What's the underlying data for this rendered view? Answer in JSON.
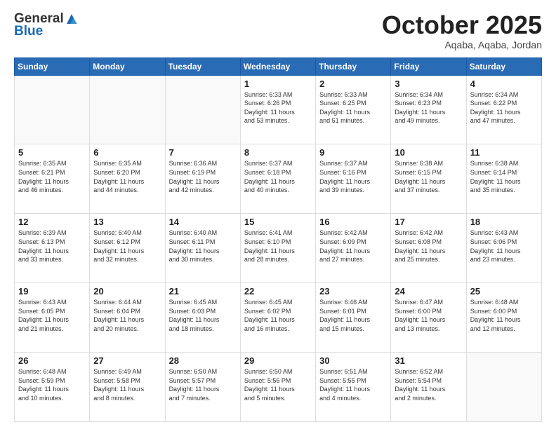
{
  "header": {
    "logo_line1": "General",
    "logo_line2": "Blue",
    "month": "October 2025",
    "location": "Aqaba, Aqaba, Jordan"
  },
  "weekdays": [
    "Sunday",
    "Monday",
    "Tuesday",
    "Wednesday",
    "Thursday",
    "Friday",
    "Saturday"
  ],
  "weeks": [
    [
      {
        "day": "",
        "info": ""
      },
      {
        "day": "",
        "info": ""
      },
      {
        "day": "",
        "info": ""
      },
      {
        "day": "1",
        "info": "Sunrise: 6:33 AM\nSunset: 6:26 PM\nDaylight: 11 hours\nand 53 minutes."
      },
      {
        "day": "2",
        "info": "Sunrise: 6:33 AM\nSunset: 6:25 PM\nDaylight: 11 hours\nand 51 minutes."
      },
      {
        "day": "3",
        "info": "Sunrise: 6:34 AM\nSunset: 6:23 PM\nDaylight: 11 hours\nand 49 minutes."
      },
      {
        "day": "4",
        "info": "Sunrise: 6:34 AM\nSunset: 6:22 PM\nDaylight: 11 hours\nand 47 minutes."
      }
    ],
    [
      {
        "day": "5",
        "info": "Sunrise: 6:35 AM\nSunset: 6:21 PM\nDaylight: 11 hours\nand 46 minutes."
      },
      {
        "day": "6",
        "info": "Sunrise: 6:35 AM\nSunset: 6:20 PM\nDaylight: 11 hours\nand 44 minutes."
      },
      {
        "day": "7",
        "info": "Sunrise: 6:36 AM\nSunset: 6:19 PM\nDaylight: 11 hours\nand 42 minutes."
      },
      {
        "day": "8",
        "info": "Sunrise: 6:37 AM\nSunset: 6:18 PM\nDaylight: 11 hours\nand 40 minutes."
      },
      {
        "day": "9",
        "info": "Sunrise: 6:37 AM\nSunset: 6:16 PM\nDaylight: 11 hours\nand 39 minutes."
      },
      {
        "day": "10",
        "info": "Sunrise: 6:38 AM\nSunset: 6:15 PM\nDaylight: 11 hours\nand 37 minutes."
      },
      {
        "day": "11",
        "info": "Sunrise: 6:38 AM\nSunset: 6:14 PM\nDaylight: 11 hours\nand 35 minutes."
      }
    ],
    [
      {
        "day": "12",
        "info": "Sunrise: 6:39 AM\nSunset: 6:13 PM\nDaylight: 11 hours\nand 33 minutes."
      },
      {
        "day": "13",
        "info": "Sunrise: 6:40 AM\nSunset: 6:12 PM\nDaylight: 11 hours\nand 32 minutes."
      },
      {
        "day": "14",
        "info": "Sunrise: 6:40 AM\nSunset: 6:11 PM\nDaylight: 11 hours\nand 30 minutes."
      },
      {
        "day": "15",
        "info": "Sunrise: 6:41 AM\nSunset: 6:10 PM\nDaylight: 11 hours\nand 28 minutes."
      },
      {
        "day": "16",
        "info": "Sunrise: 6:42 AM\nSunset: 6:09 PM\nDaylight: 11 hours\nand 27 minutes."
      },
      {
        "day": "17",
        "info": "Sunrise: 6:42 AM\nSunset: 6:08 PM\nDaylight: 11 hours\nand 25 minutes."
      },
      {
        "day": "18",
        "info": "Sunrise: 6:43 AM\nSunset: 6:06 PM\nDaylight: 11 hours\nand 23 minutes."
      }
    ],
    [
      {
        "day": "19",
        "info": "Sunrise: 6:43 AM\nSunset: 6:05 PM\nDaylight: 11 hours\nand 21 minutes."
      },
      {
        "day": "20",
        "info": "Sunrise: 6:44 AM\nSunset: 6:04 PM\nDaylight: 11 hours\nand 20 minutes."
      },
      {
        "day": "21",
        "info": "Sunrise: 6:45 AM\nSunset: 6:03 PM\nDaylight: 11 hours\nand 18 minutes."
      },
      {
        "day": "22",
        "info": "Sunrise: 6:45 AM\nSunset: 6:02 PM\nDaylight: 11 hours\nand 16 minutes."
      },
      {
        "day": "23",
        "info": "Sunrise: 6:46 AM\nSunset: 6:01 PM\nDaylight: 11 hours\nand 15 minutes."
      },
      {
        "day": "24",
        "info": "Sunrise: 6:47 AM\nSunset: 6:00 PM\nDaylight: 11 hours\nand 13 minutes."
      },
      {
        "day": "25",
        "info": "Sunrise: 6:48 AM\nSunset: 6:00 PM\nDaylight: 11 hours\nand 12 minutes."
      }
    ],
    [
      {
        "day": "26",
        "info": "Sunrise: 6:48 AM\nSunset: 5:59 PM\nDaylight: 11 hours\nand 10 minutes."
      },
      {
        "day": "27",
        "info": "Sunrise: 6:49 AM\nSunset: 5:58 PM\nDaylight: 11 hours\nand 8 minutes."
      },
      {
        "day": "28",
        "info": "Sunrise: 6:50 AM\nSunset: 5:57 PM\nDaylight: 11 hours\nand 7 minutes."
      },
      {
        "day": "29",
        "info": "Sunrise: 6:50 AM\nSunset: 5:56 PM\nDaylight: 11 hours\nand 5 minutes."
      },
      {
        "day": "30",
        "info": "Sunrise: 6:51 AM\nSunset: 5:55 PM\nDaylight: 11 hours\nand 4 minutes."
      },
      {
        "day": "31",
        "info": "Sunrise: 6:52 AM\nSunset: 5:54 PM\nDaylight: 11 hours\nand 2 minutes."
      },
      {
        "day": "",
        "info": ""
      }
    ]
  ]
}
